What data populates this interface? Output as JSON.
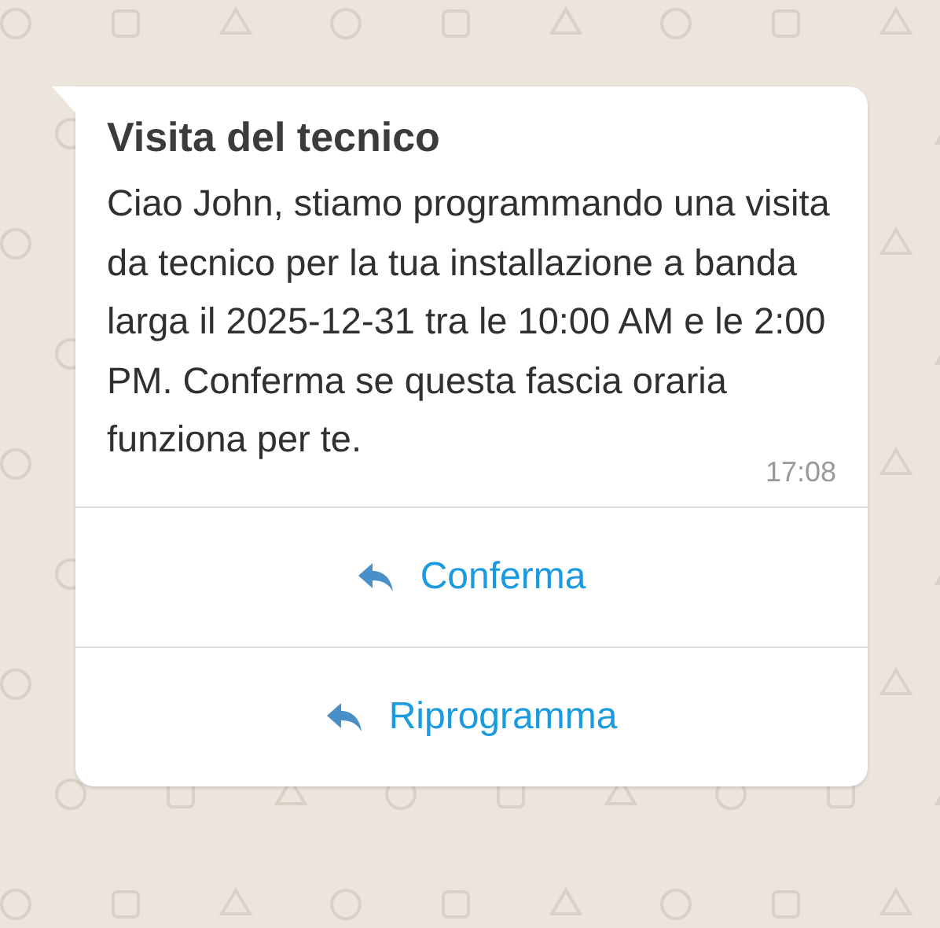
{
  "message": {
    "title": "Visita del tecnico",
    "body": "Ciao John, stiamo programmando una visita da tecnico per la tua installazione a banda larga il 2025-12-31 tra le 10:00 AM e le 2:00 PM. Conferma se questa fascia oraria funziona per te.",
    "time": "17:08"
  },
  "buttons": [
    {
      "label": "Conferma"
    },
    {
      "label": "Riprogramma"
    }
  ]
}
